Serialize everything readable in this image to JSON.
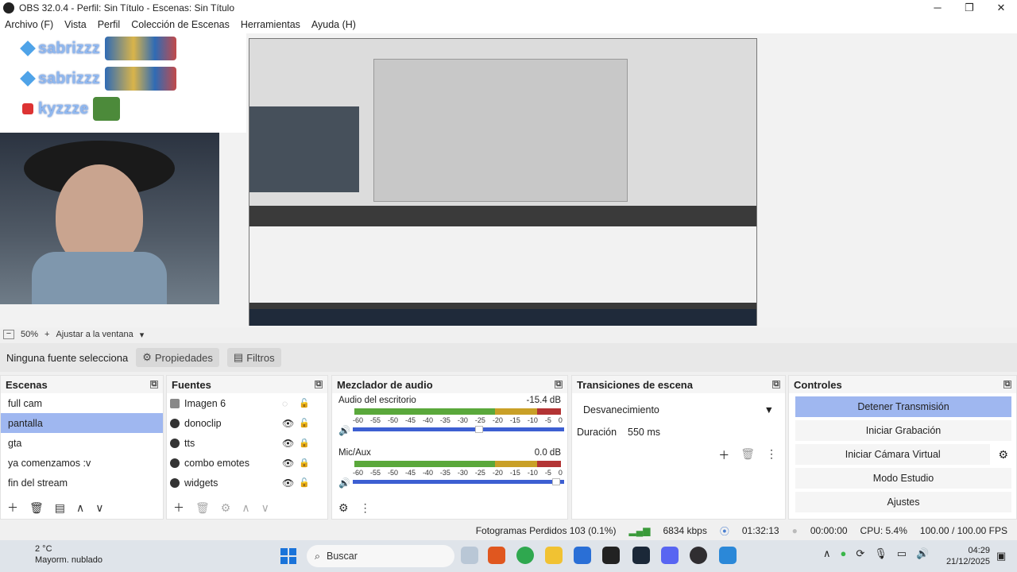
{
  "window": {
    "title": "OBS 32.0.4 - Perfil: Sin Título - Escenas: Sin Título",
    "minimize": "─",
    "maximize": "❐",
    "close": "✕"
  },
  "menu": [
    "Archivo (F)",
    "Vista",
    "Perfil",
    "Colección de Escenas",
    "Herramientas",
    "Ayuda (H)"
  ],
  "chat": [
    {
      "name": "sabrizzz",
      "badge": "blue"
    },
    {
      "name": "sabrizzz",
      "badge": "blue"
    },
    {
      "name": "kyzzze",
      "badge": "red"
    },
    {
      "name": "sabrizzz",
      "badge": "blue"
    }
  ],
  "zoom": {
    "minus": "−",
    "value": "50%",
    "plus": "+",
    "fit": "Ajustar a la ventana",
    "arrow": "▾"
  },
  "source_toolbar": {
    "none_selected": "Ninguna fuente selecciona",
    "properties": "Propiedades",
    "filters": "Filtros"
  },
  "scenes": {
    "title": "Escenas",
    "items": [
      "full cam",
      "pantalla",
      "gta",
      "ya comenzamos :v",
      "fin del stream"
    ],
    "selected_index": 1
  },
  "sources": {
    "title": "Fuentes",
    "items": [
      {
        "name": "Imagen 6",
        "visible": false,
        "locked": false
      },
      {
        "name": "donoclip",
        "visible": true,
        "locked": false
      },
      {
        "name": "tts",
        "visible": true,
        "locked": true
      },
      {
        "name": "combo emotes",
        "visible": true,
        "locked": true
      },
      {
        "name": "widgets",
        "visible": true,
        "locked": false
      }
    ]
  },
  "mixer": {
    "title": "Mezclador de audio",
    "channels": [
      {
        "name": "Audio del escritorio",
        "db": "-15.4 dB",
        "volume_fraction": 0.6
      },
      {
        "name": "Mic/Aux",
        "db": "0.0 dB",
        "volume_fraction": 0.98
      }
    ],
    "scale": [
      "-60",
      "-55",
      "-50",
      "-45",
      "-40",
      "-35",
      "-30",
      "-25",
      "-20",
      "-15",
      "-10",
      "-5",
      "0"
    ]
  },
  "transitions": {
    "title": "Transiciones de escena",
    "selected": "Desvanecimiento",
    "duration_label": "Duración",
    "duration_value": "550 ms"
  },
  "controls": {
    "title": "Controles",
    "buttons": [
      "Detener Transmisión",
      "Iniciar Grabación",
      "Iniciar Cámara Virtual",
      "Modo Estudio",
      "Ajustes"
    ]
  },
  "status": {
    "dropped": "Fotogramas Perdidos 103 (0.1%)",
    "bitrate": "6834 kbps",
    "stream_time": "01:32:13",
    "rec_time": "00:00:00",
    "cpu": "CPU: 5.4%",
    "fps": "100.00 / 100.00 FPS"
  },
  "taskbar": {
    "weather_temp": "2 °C",
    "weather_desc": "Mayorm. nublado",
    "search": "Buscar",
    "time": "04:29",
    "date": "21/12/2025"
  },
  "colors": {
    "selection": "#9fb7f0",
    "accent": "#3d5fd2"
  }
}
